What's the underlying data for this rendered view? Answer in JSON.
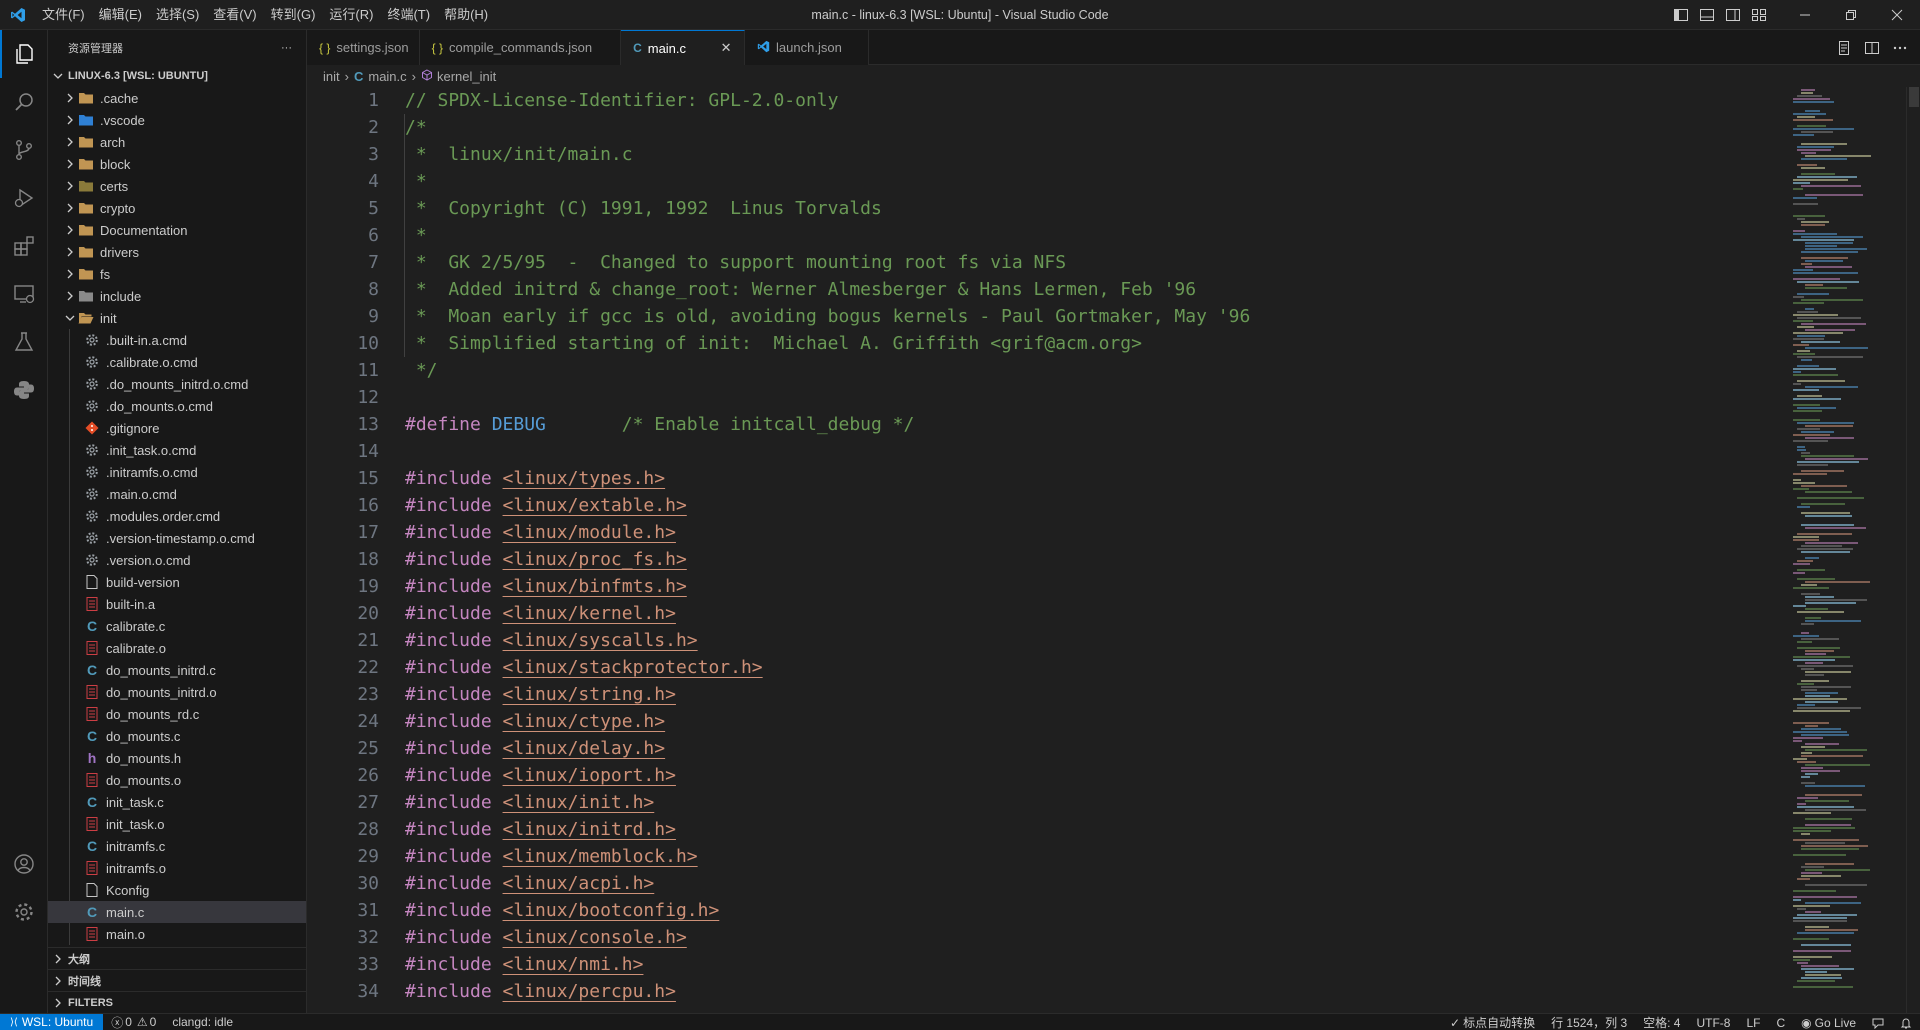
{
  "titlebar": {
    "menu": [
      "文件(F)",
      "编辑(E)",
      "选择(S)",
      "查看(V)",
      "转到(G)",
      "运行(R)",
      "终端(T)",
      "帮助(H)"
    ],
    "title": "main.c - linux-6.3 [WSL: Ubuntu] - Visual Studio Code"
  },
  "sidebar": {
    "header": "资源管理器",
    "more": "···",
    "root_label": "LINUX-6.3 [WSL: UBUNTU]",
    "folders": [
      {
        "name": ".cache",
        "icon": "folder-icon",
        "color": "#c09553"
      },
      {
        "name": ".vscode",
        "icon": "vscode-folder-icon",
        "color": "#2f80d4"
      },
      {
        "name": "arch",
        "icon": "folder-icon",
        "color": "#c09553"
      },
      {
        "name": "block",
        "icon": "folder-icon",
        "color": "#c09553"
      },
      {
        "name": "certs",
        "icon": "folder-icon",
        "color": "#8a7a3a"
      },
      {
        "name": "crypto",
        "icon": "folder-icon",
        "color": "#c09553"
      },
      {
        "name": "Documentation",
        "icon": "folder-icon",
        "color": "#c09553"
      },
      {
        "name": "drivers",
        "icon": "folder-icon",
        "color": "#c09553"
      },
      {
        "name": "fs",
        "icon": "folder-icon",
        "color": "#c09553"
      },
      {
        "name": "include",
        "icon": "include-folder-icon",
        "color": "#8a8a8a"
      }
    ],
    "open_folder": "init",
    "files": [
      {
        "name": ".built-in.a.cmd",
        "type": "gear"
      },
      {
        "name": ".calibrate.o.cmd",
        "type": "gear"
      },
      {
        "name": ".do_mounts_initrd.o.cmd",
        "type": "gear"
      },
      {
        "name": ".do_mounts.o.cmd",
        "type": "gear"
      },
      {
        "name": ".gitignore",
        "type": "git"
      },
      {
        "name": ".init_task.o.cmd",
        "type": "gear"
      },
      {
        "name": ".initramfs.o.cmd",
        "type": "gear"
      },
      {
        "name": ".main.o.cmd",
        "type": "gear"
      },
      {
        "name": ".modules.order.cmd",
        "type": "gear"
      },
      {
        "name": ".version-timestamp.o.cmd",
        "type": "gear"
      },
      {
        "name": ".version.o.cmd",
        "type": "gear"
      },
      {
        "name": "build-version",
        "type": "file"
      },
      {
        "name": "built-in.a",
        "type": "bin"
      },
      {
        "name": "calibrate.c",
        "type": "c"
      },
      {
        "name": "calibrate.o",
        "type": "bin"
      },
      {
        "name": "do_mounts_initrd.c",
        "type": "c"
      },
      {
        "name": "do_mounts_initrd.o",
        "type": "bin"
      },
      {
        "name": "do_mounts_rd.c",
        "type": "bin"
      },
      {
        "name": "do_mounts.c",
        "type": "c"
      },
      {
        "name": "do_mounts.h",
        "type": "h"
      },
      {
        "name": "do_mounts.o",
        "type": "bin"
      },
      {
        "name": "init_task.c",
        "type": "c"
      },
      {
        "name": "init_task.o",
        "type": "bin"
      },
      {
        "name": "initramfs.c",
        "type": "c"
      },
      {
        "name": "initramfs.o",
        "type": "bin"
      },
      {
        "name": "Kconfig",
        "type": "file"
      },
      {
        "name": "main.c",
        "type": "c",
        "selected": true
      },
      {
        "name": "main.o",
        "type": "bin"
      }
    ],
    "sections": [
      "大纲",
      "时间线",
      "FILTERS"
    ]
  },
  "tabs": [
    {
      "label": "settings.json",
      "icon": "{ }",
      "active": false
    },
    {
      "label": "compile_commands.json",
      "icon": "{ }",
      "active": false
    },
    {
      "label": "main.c",
      "icon": "C",
      "active": true,
      "close": "✕"
    },
    {
      "label": "launch.json",
      "icon": "vscode",
      "active": false
    }
  ],
  "breadcrumb": {
    "folder": "init",
    "file": "main.c",
    "symbol": "kernel_init"
  },
  "editor": {
    "line_numbers": [
      "1",
      "2",
      "3",
      "4",
      "5",
      "6",
      "7",
      "8",
      "9",
      "10",
      "11",
      "12",
      "13",
      "14",
      "15",
      "16",
      "17",
      "18",
      "19",
      "20",
      "21",
      "22",
      "23",
      "24",
      "25",
      "26",
      "27",
      "28",
      "29",
      "30",
      "31",
      "32",
      "33",
      "34"
    ],
    "comment_lines": [
      "// SPDX-License-Identifier: GPL-2.0-only",
      "/*",
      " *  linux/init/main.c",
      " *",
      " *  Copyright (C) 1991, 1992  Linus Torvalds",
      " *",
      " *  GK 2/5/95  -  Changed to support mounting root fs via NFS",
      " *  Added initrd & change_root: Werner Almesberger & Hans Lermen, Feb '96",
      " *  Moan early if gcc is old, avoiding bogus kernels - Paul Gortmaker, May '96",
      " *  Simplified starting of init:  Michael A. Griffith <grif@acm.org>",
      " */"
    ],
    "define": {
      "keyword": "#define",
      "name": "DEBUG",
      "comment": "/* Enable initcall_debug */"
    },
    "include_keyword": "#include",
    "includes": [
      "<linux/types.h>",
      "<linux/extable.h>",
      "<linux/module.h>",
      "<linux/proc_fs.h>",
      "<linux/binfmts.h>",
      "<linux/kernel.h>",
      "<linux/syscalls.h>",
      "<linux/stackprotector.h>",
      "<linux/string.h>",
      "<linux/ctype.h>",
      "<linux/delay.h>",
      "<linux/ioport.h>",
      "<linux/init.h>",
      "<linux/initrd.h>",
      "<linux/memblock.h>",
      "<linux/acpi.h>",
      "<linux/bootconfig.h>",
      "<linux/console.h>",
      "<linux/nmi.h>",
      "<linux/percpu.h>"
    ]
  },
  "statusbar": {
    "remote": "WSL: Ubuntu",
    "errors": "0",
    "warnings": "0",
    "clangd": "clangd: idle",
    "punct": "标点自动转换",
    "position": "行 1524，列 3",
    "spaces": "空格: 4",
    "encoding": "UTF-8",
    "eol": "LF",
    "language": "C",
    "golive": "Go Live"
  }
}
